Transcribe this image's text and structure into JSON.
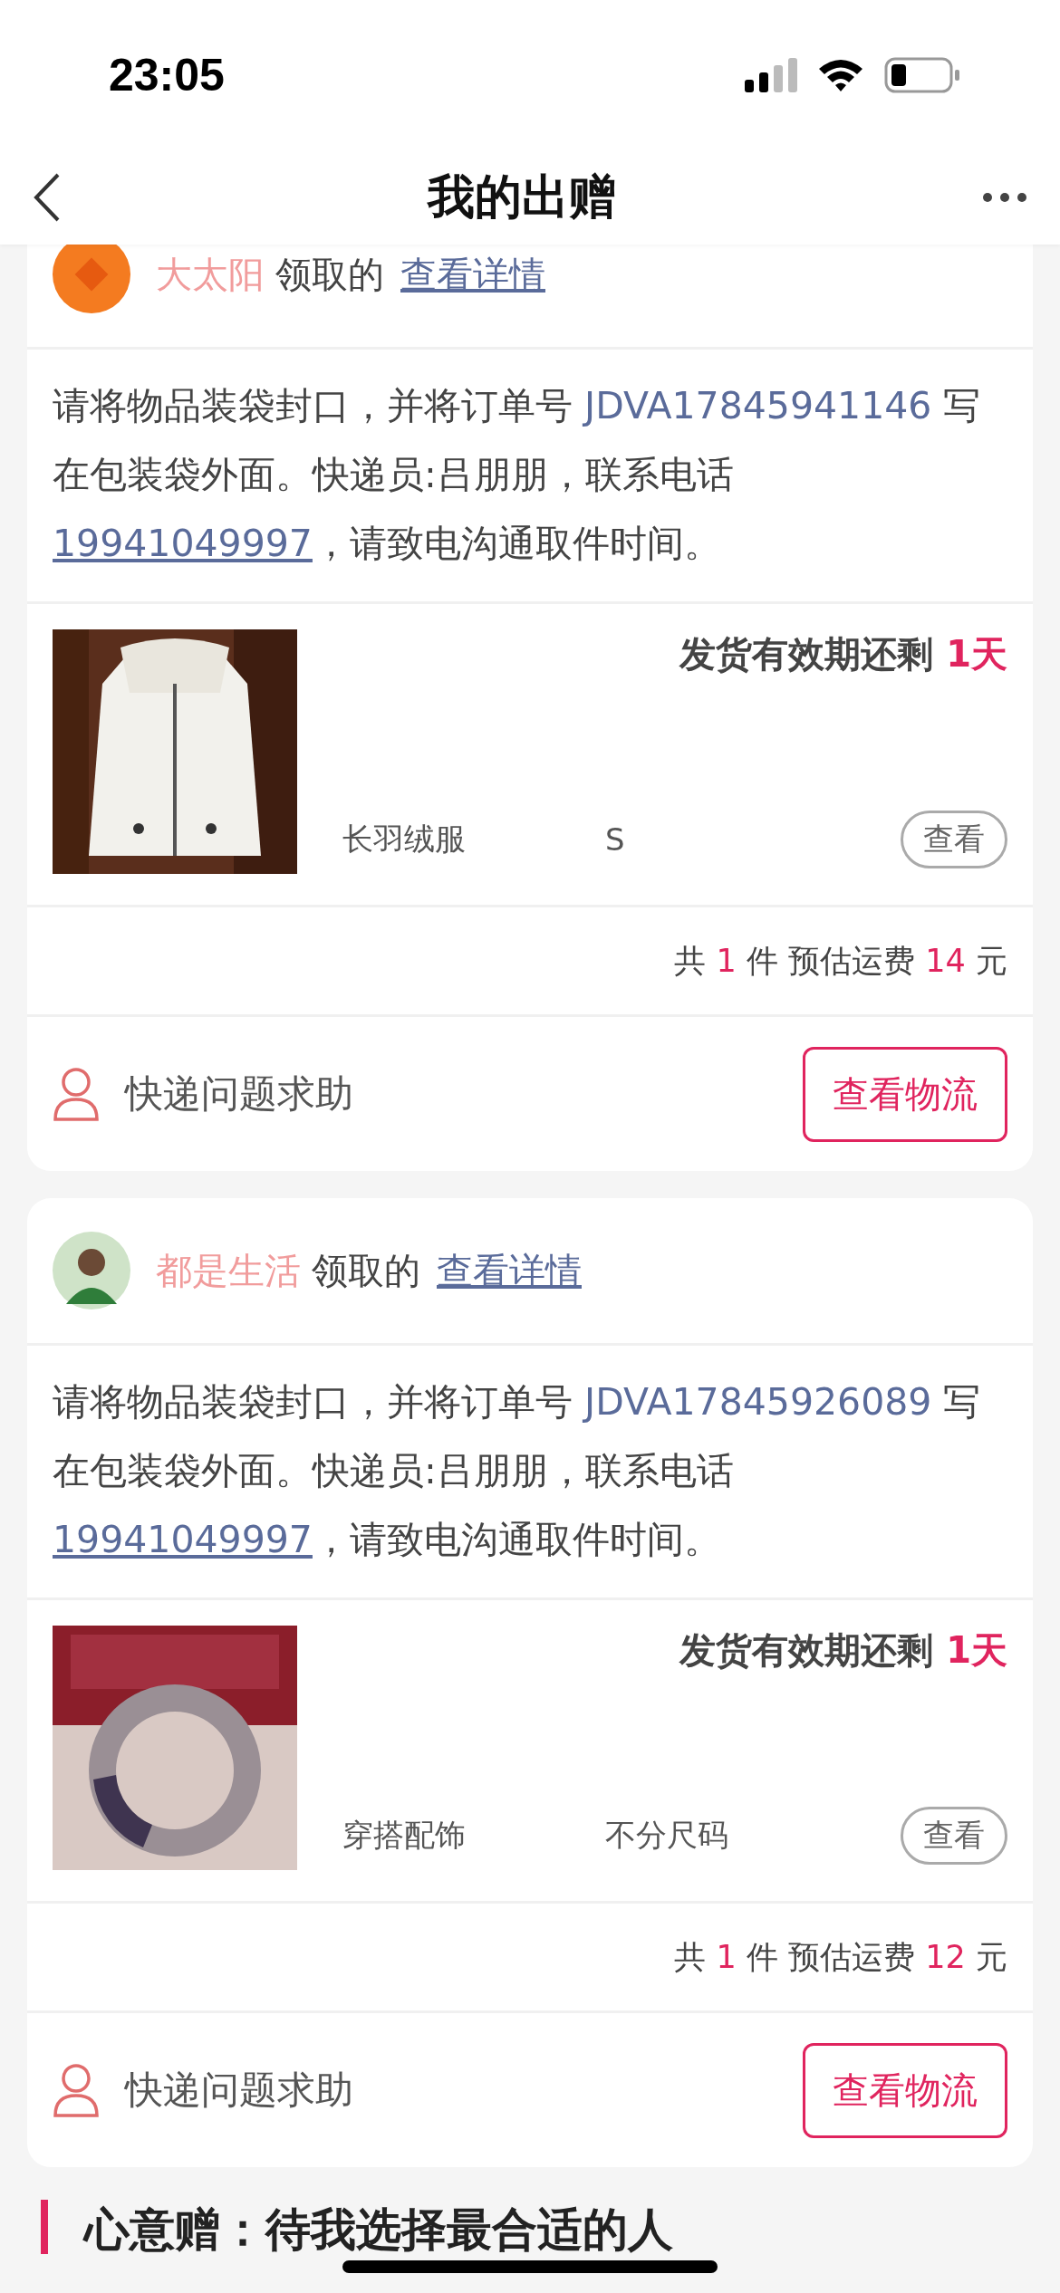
{
  "status_bar": {
    "time": "23:05"
  },
  "nav": {
    "title": "我的出赠"
  },
  "cards": [
    {
      "receiver": "大太阳",
      "claimed": "领取的",
      "details_link": "查看详情",
      "message": {
        "before": "请将物品装袋封口，并将订单号 ",
        "order_no": "JDVA17845941146",
        "middle": " 写在包装袋外面。快递员:吕朋朋，联系电话",
        "phone": "19941049997",
        "after": "，请致电沟通取件时间。"
      },
      "expiry": {
        "label": "发货有效期还剩",
        "days": "1天"
      },
      "item": {
        "name": "长羽绒服",
        "size": "S",
        "view_button": "查看"
      },
      "totals": {
        "prefix": "共",
        "count": "1",
        "middle": "件 预估运费",
        "fee": "14",
        "suffix": "元"
      },
      "help": "快递问题求助",
      "logistics_button": "查看物流"
    },
    {
      "receiver": "都是生活",
      "claimed": "领取的",
      "details_link": "查看详情",
      "message": {
        "before": "请将物品装袋封口，并将订单号 ",
        "order_no": "JDVA17845926089",
        "middle": " 写在包装袋外面。快递员:吕朋朋，联系电话",
        "phone": "19941049997",
        "after": "，请致电沟通取件时间。"
      },
      "expiry": {
        "label": "发货有效期还剩",
        "days": "1天"
      },
      "item": {
        "name": "穿搭配饰",
        "size": "不分尺码",
        "view_button": "查看"
      },
      "totals": {
        "prefix": "共",
        "count": "1",
        "middle": "件 预估运费",
        "fee": "12",
        "suffix": "元"
      },
      "help": "快递问题求助",
      "logistics_button": "查看物流"
    }
  ],
  "section_title": "心意赠：待我选择最合适的人"
}
